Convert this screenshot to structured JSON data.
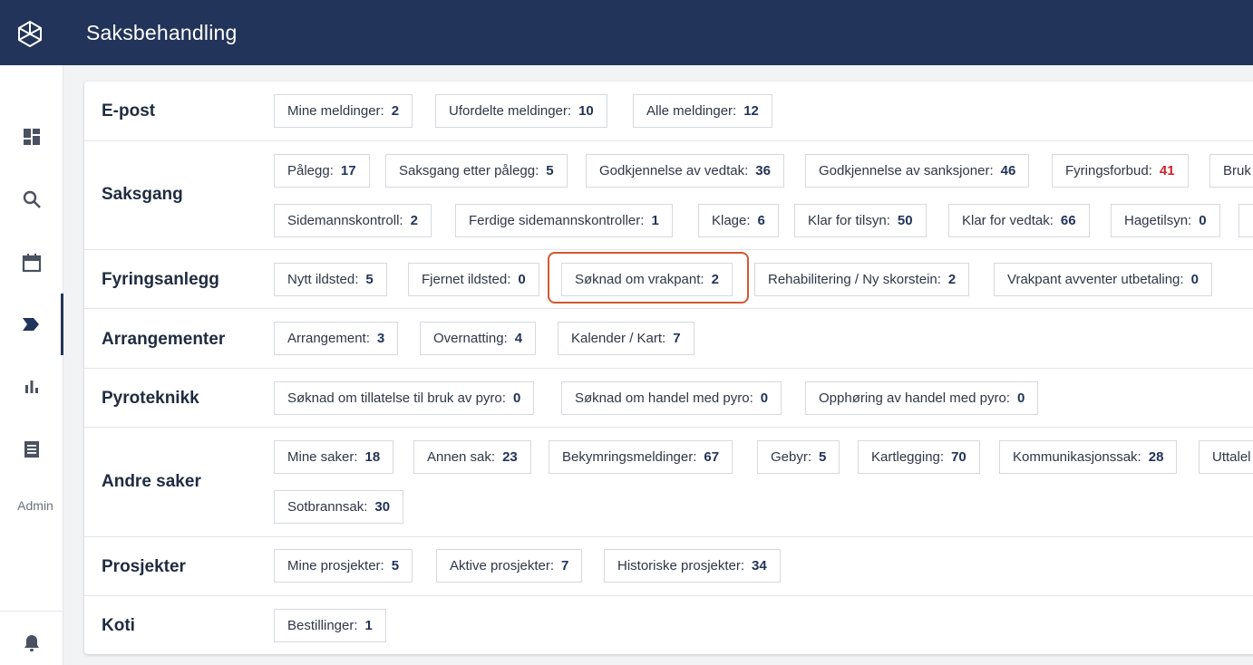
{
  "header": {
    "title": "Saksbehandling"
  },
  "sidebar": {
    "admin_label": "Admin"
  },
  "sections": {
    "epost": {
      "label": "E-post",
      "chips": [
        {
          "label": "Mine meldinger:",
          "count": "2"
        },
        {
          "label": "Ufordelte meldinger:",
          "count": "10"
        },
        {
          "label": "Alle meldinger:",
          "count": "12"
        }
      ]
    },
    "saksgang": {
      "label": "Saksgang",
      "chips": [
        {
          "label": "Pålegg:",
          "count": "17"
        },
        {
          "label": "Saksgang etter pålegg:",
          "count": "5"
        },
        {
          "label": "Godkjennelse av vedtak:",
          "count": "36"
        },
        {
          "label": "Godkjennelse av sanksjoner:",
          "count": "46"
        },
        {
          "label": "Fyringsforbud:",
          "count": "41"
        },
        {
          "label": "Bruk",
          "count": ""
        },
        {
          "label": "Sidemannskontroll:",
          "count": "2"
        },
        {
          "label": "Ferdige sidemannskontroller:",
          "count": "1"
        },
        {
          "label": "Klage:",
          "count": "6"
        },
        {
          "label": "Klar for tilsyn:",
          "count": "50"
        },
        {
          "label": "Klar for vedtak:",
          "count": "66"
        },
        {
          "label": "Hagetilsyn:",
          "count": "0"
        }
      ]
    },
    "fyringsanlegg": {
      "label": "Fyringsanlegg",
      "chips": [
        {
          "label": "Nytt ildsted:",
          "count": "5"
        },
        {
          "label": "Fjernet ildsted:",
          "count": "0"
        },
        {
          "label": "Søknad om vrakpant:",
          "count": "2"
        },
        {
          "label": "Rehabilitering / Ny skorstein:",
          "count": "2"
        },
        {
          "label": "Vrakpant avventer utbetaling:",
          "count": "0"
        }
      ]
    },
    "arrangementer": {
      "label": "Arrangementer",
      "chips": [
        {
          "label": "Arrangement:",
          "count": "3"
        },
        {
          "label": "Overnatting:",
          "count": "4"
        },
        {
          "label": "Kalender / Kart:",
          "count": "7"
        }
      ]
    },
    "pyroteknikk": {
      "label": "Pyroteknikk",
      "chips": [
        {
          "label": "Søknad om tillatelse til bruk av pyro:",
          "count": "0"
        },
        {
          "label": "Søknad om handel med pyro:",
          "count": "0"
        },
        {
          "label": "Opphøring av handel med pyro:",
          "count": "0"
        }
      ]
    },
    "andre": {
      "label": "Andre saker",
      "chips": [
        {
          "label": "Mine saker:",
          "count": "18"
        },
        {
          "label": "Annen sak:",
          "count": "23"
        },
        {
          "label": "Bekymringsmeldinger:",
          "count": "67"
        },
        {
          "label": "Gebyr:",
          "count": "5"
        },
        {
          "label": "Kartlegging:",
          "count": "70"
        },
        {
          "label": "Kommunikasjonssak:",
          "count": "28"
        },
        {
          "label": "Uttalel",
          "count": ""
        },
        {
          "label": "Sotbrannsak:",
          "count": "30"
        }
      ]
    },
    "prosjekter": {
      "label": "Prosjekter",
      "chips": [
        {
          "label": "Mine prosjekter:",
          "count": "5"
        },
        {
          "label": "Aktive prosjekter:",
          "count": "7"
        },
        {
          "label": "Historiske prosjekter:",
          "count": "34"
        }
      ]
    },
    "koti": {
      "label": "Koti",
      "chips": [
        {
          "label": "Bestillinger:",
          "count": "1"
        }
      ]
    }
  },
  "colors": {
    "header_bg": "#223459",
    "count_alert": "#d0202a",
    "highlight": "#d4572f"
  }
}
